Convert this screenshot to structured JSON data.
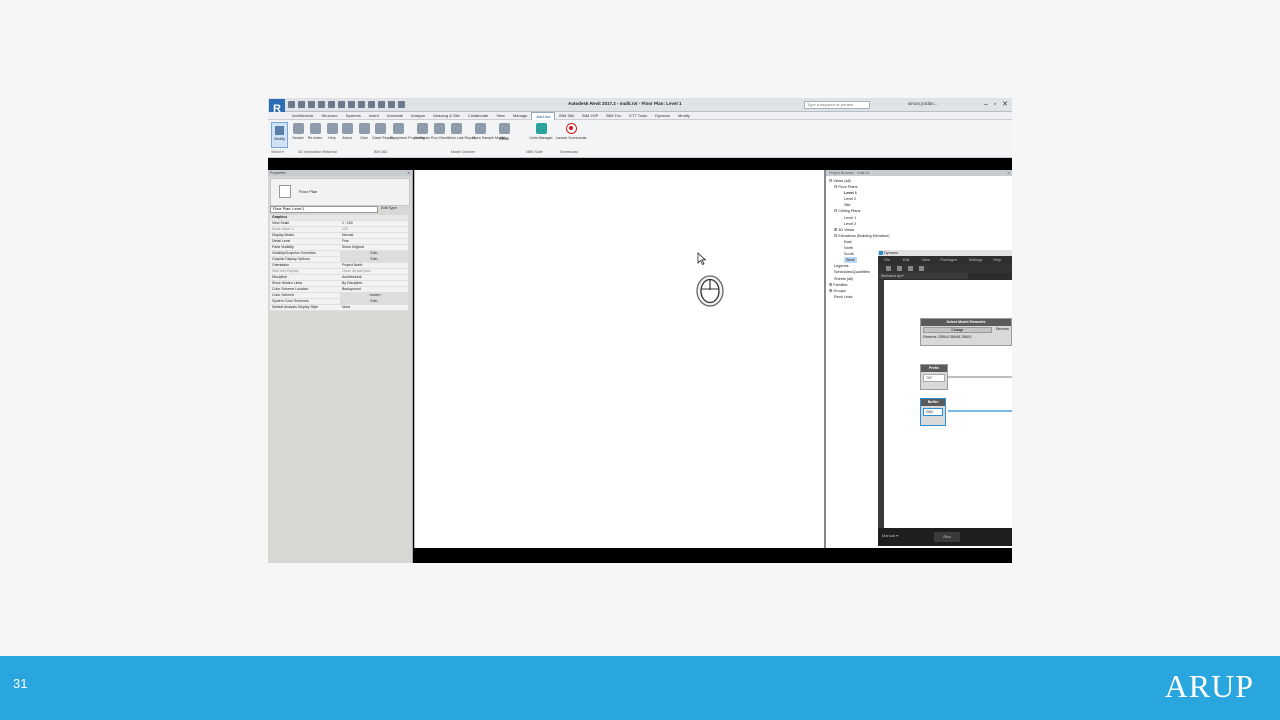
{
  "slide": {
    "page_number": "31",
    "brand": "ARUP"
  },
  "revit": {
    "logo": "R",
    "title": "Autodesk Revit 2017.2 -   multi.rvt - Floor Plan: Level 1",
    "search_placeholder": "Type a keyword or phrase",
    "user": "simon.jordan...",
    "tabs": [
      "Architecture",
      "Structure",
      "Systems",
      "Insert",
      "Annotate",
      "Analyze",
      "Massing & Site",
      "Collaborate",
      "View",
      "Manage",
      "Add-Ins",
      "BIM 360",
      "BIM 2GP",
      "BIM Fox",
      "ETT Tools",
      "Dynamo",
      "Modify"
    ],
    "active_tab": "Add-Ins",
    "ribbon": {
      "modify": "Modify",
      "select": "Select ▾",
      "buttons": [
        {
          "label": "Search"
        },
        {
          "label": "Re-index"
        },
        {
          "label": "Help"
        },
        {
          "label": "About"
        },
        {
          "label": "Glue"
        },
        {
          "label": "Clash Report"
        },
        {
          "label": "Equipment Properties"
        },
        {
          "label": "Configure"
        },
        {
          "label": "Run Check"
        },
        {
          "label": "View Last Report"
        },
        {
          "label": "Open Sample Model"
        },
        {
          "label": "Help"
        },
        {
          "label": "About"
        },
        {
          "label": "Units Manager"
        },
        {
          "label": "Launch Screencast"
        }
      ],
      "panels": [
        "3D Information Retrieval",
        "BIM 360",
        "Model Checker",
        "NBS Suite",
        "Screencast"
      ]
    },
    "properties": {
      "header": "Properties",
      "type_name": "Floor Plan",
      "instance_select": "Floor Plan: Level 1",
      "edit_type": "Edit Type",
      "rows": [
        {
          "k": "Graphics",
          "v": "",
          "group": true
        },
        {
          "k": "View Scale",
          "v": "1 : 100"
        },
        {
          "k": "Scale Value   1:",
          "v": "100",
          "grey": true
        },
        {
          "k": "Display Model",
          "v": "Normal"
        },
        {
          "k": "Detail Level",
          "v": "Fine"
        },
        {
          "k": "Parts Visibility",
          "v": "Show Original"
        },
        {
          "k": "Visibility/Graphics Overrides",
          "v": "Edit...",
          "btn": true
        },
        {
          "k": "Graphic Display Options",
          "v": "Edit...",
          "btn": true
        },
        {
          "k": "Orientation",
          "v": "Project North"
        },
        {
          "k": "Wall Join Display",
          "v": "Clean all wall joins",
          "grey": true
        },
        {
          "k": "Discipline",
          "v": "Architectural"
        },
        {
          "k": "Show Hidden Lines",
          "v": "By Discipline"
        },
        {
          "k": "Color Scheme Location",
          "v": "Background"
        },
        {
          "k": "Color Scheme",
          "v": "<none>",
          "btn": true
        },
        {
          "k": "System Color Schemes",
          "v": "Edit...",
          "btn": true
        },
        {
          "k": "Default Analysis Display Style",
          "v": "None"
        }
      ]
    },
    "browser": {
      "header": "Project Browser - multi.rvt",
      "items": [
        {
          "label": "⊟ Views (all)",
          "indent": 0
        },
        {
          "label": "⊟ Floor Plans",
          "indent": 1
        },
        {
          "label": "Level 1",
          "indent": 3,
          "bold": true
        },
        {
          "label": "Level 2",
          "indent": 3
        },
        {
          "label": "Site",
          "indent": 3
        },
        {
          "label": "⊟ Ceiling Plans",
          "indent": 1
        },
        {
          "label": "Level 1",
          "indent": 3
        },
        {
          "label": "Level 2",
          "indent": 3
        },
        {
          "label": "⊞ 3D Views",
          "indent": 1
        },
        {
          "label": "⊟ Elevations (Building Elevation)",
          "indent": 1
        },
        {
          "label": "East",
          "indent": 3
        },
        {
          "label": "North",
          "indent": 3
        },
        {
          "label": "South",
          "indent": 3
        },
        {
          "label": "West",
          "indent": 3,
          "selected": true
        },
        {
          "label": "Legends",
          "indent": 1
        },
        {
          "label": "Schedules/Quantities",
          "indent": 1
        },
        {
          "label": "Sheets (all)",
          "indent": 1
        },
        {
          "label": "⊞ Families",
          "indent": 0
        },
        {
          "label": "⊞ Groups",
          "indent": 0
        },
        {
          "label": "Revit Links",
          "indent": 1
        }
      ]
    }
  },
  "dynamo": {
    "title": "Dynamo",
    "menu": [
      "File",
      "Edit",
      "View",
      "Packages",
      "Settings",
      "Help"
    ],
    "file_tab": "Workarea.dyn*",
    "select_node": {
      "title": "Select Model Elements",
      "change": "Change",
      "elements_tab": "Elements",
      "value": "Elements: 259544 258468 258451"
    },
    "prefix_node": {
      "title": "Prefix",
      "value": "\"XX\""
    },
    "buffer_node": {
      "title": "Buffer",
      "value": "2000"
    },
    "run_mode": "Manual",
    "run_label": "Run"
  },
  "icons": {
    "cursor": "mouse-pointer-icon",
    "mouse": "mouse-icon",
    "record": "record-icon"
  },
  "colors": {
    "footer": "#29a6de",
    "revit_blue": "#2a6db4",
    "dynamo_dark": "#2c2c2c"
  }
}
